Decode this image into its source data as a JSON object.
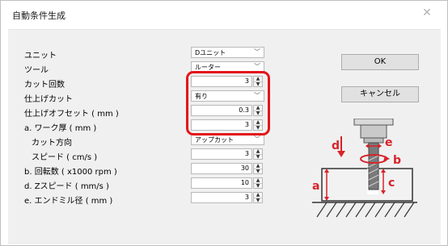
{
  "window": {
    "title": "自動条件生成",
    "close_icon": "close-icon"
  },
  "rows": [
    {
      "label": "ユニット",
      "control": "select",
      "value": "Dユニット"
    },
    {
      "label": "ツール",
      "control": "select",
      "value": "ルーター"
    },
    {
      "label": "カット回数",
      "control": "spin",
      "value": "3"
    },
    {
      "label": "仕上げカット",
      "control": "select",
      "value": "有り"
    },
    {
      "label": "仕上げオフセット ( mm )",
      "control": "spin",
      "value": "0.3"
    },
    {
      "label": "a. ワーク厚 ( mm )",
      "control": "spin",
      "value": "3"
    },
    {
      "label": "カット方向",
      "control": "select",
      "value": "アップカット"
    },
    {
      "label": "スピード ( cm/s )",
      "control": "spin",
      "value": "3"
    },
    {
      "label": "b. 回転数 ( x1000  rpm )",
      "control": "spin",
      "value": "30"
    },
    {
      "label": "d. Zスピード ( mm/s )",
      "control": "spin",
      "value": "10"
    },
    {
      "label": "e. エンドミル径 ( mm )",
      "control": "spin",
      "value": "3"
    }
  ],
  "buttons": {
    "ok": "OK",
    "cancel": "キャンセル"
  },
  "diagram": {
    "labels": {
      "a": "a",
      "b": "b",
      "c": "c",
      "d": "d",
      "e": "e"
    }
  },
  "colors": {
    "highlight": "#e3151a",
    "panel": "#f0f0f0",
    "annotation": "#d6242a"
  }
}
